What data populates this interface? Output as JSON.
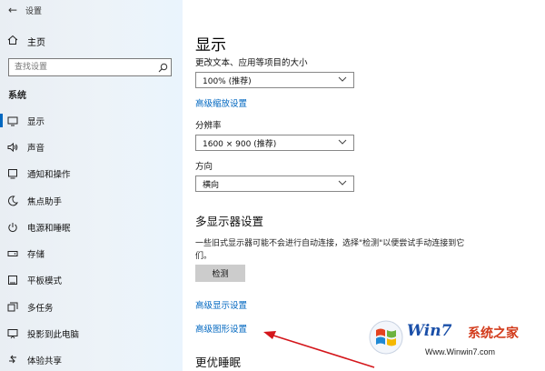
{
  "window": {
    "back_glyph": "←",
    "title": "设置"
  },
  "sidebar": {
    "home_label": "主页",
    "search_placeholder": "查找设置",
    "section_title": "系统",
    "items": [
      {
        "label": "显示",
        "icon": "monitor-icon",
        "active": true
      },
      {
        "label": "声音",
        "icon": "speaker-icon"
      },
      {
        "label": "通知和操作",
        "icon": "notification-icon"
      },
      {
        "label": "焦点助手",
        "icon": "moon-icon"
      },
      {
        "label": "电源和睡眠",
        "icon": "power-icon"
      },
      {
        "label": "存储",
        "icon": "storage-icon"
      },
      {
        "label": "平板模式",
        "icon": "tablet-icon"
      },
      {
        "label": "多任务",
        "icon": "multitask-icon"
      },
      {
        "label": "投影到此电脑",
        "icon": "project-icon"
      },
      {
        "label": "体验共享",
        "icon": "share-icon"
      }
    ]
  },
  "main": {
    "title": "显示",
    "scale_label": "更改文本、应用等项目的大小",
    "scale_value": "100% (推荐)",
    "advanced_scaling_link": "高级缩放设置",
    "resolution_label": "分辨率",
    "resolution_value": "1600 × 900 (推荐)",
    "orientation_label": "方向",
    "orientation_value": "横向",
    "multi_display_title": "多显示器设置",
    "multi_display_desc": "一些旧式显示器可能不会进行自动连接，选择\"检测\"以便尝试手动连接到它们。",
    "detect_button": "检测",
    "advanced_display_link": "高级显示设置",
    "advanced_graphics_link": "高级图形设置",
    "sleep_title": "更优睡眠"
  },
  "watermark": {
    "brand": "Win7",
    "cn": "系统之家",
    "url": "Www.Winwin7.com"
  },
  "colors": {
    "accent": "#0067c0",
    "arrow": "#d4161b"
  }
}
